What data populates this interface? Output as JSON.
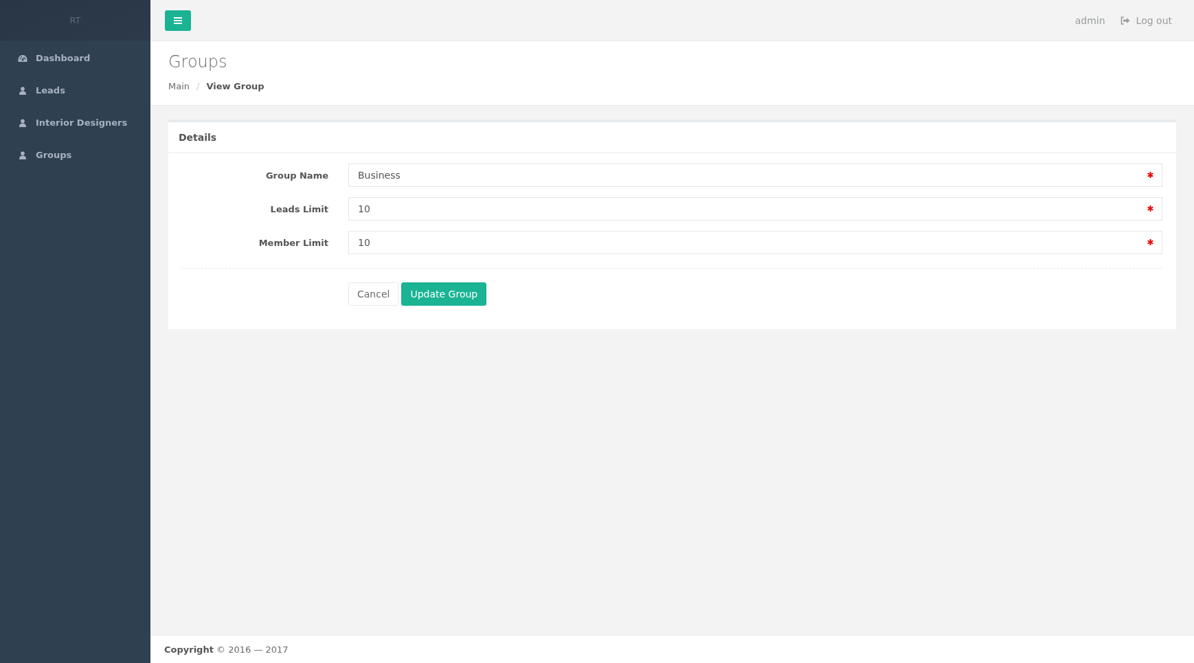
{
  "sidebar": {
    "logo": "RT",
    "items": [
      {
        "label": "Dashboard",
        "kind": "dashboard"
      },
      {
        "label": "Leads",
        "kind": "user"
      },
      {
        "label": "Interior Designers",
        "kind": "user"
      },
      {
        "label": "Groups",
        "kind": "user"
      }
    ]
  },
  "topbar": {
    "user": "admin",
    "logout": "Log out"
  },
  "page": {
    "title": "Groups",
    "breadcrumb": [
      "Main",
      "View Group"
    ],
    "breadcrumb_separator": "/"
  },
  "panel": {
    "title": "Details",
    "fields": [
      {
        "label": "Group Name",
        "value": "Business",
        "required": true
      },
      {
        "label": "Leads Limit",
        "value": "10",
        "required": true
      },
      {
        "label": "Member Limit",
        "value": "10",
        "required": true
      }
    ],
    "buttons": [
      {
        "label": "Cancel",
        "kind": "default"
      },
      {
        "label": "Update Group",
        "kind": "primary"
      }
    ]
  },
  "footer": {
    "owner": "Copyright",
    "text": "© 2016 — 2017"
  }
}
